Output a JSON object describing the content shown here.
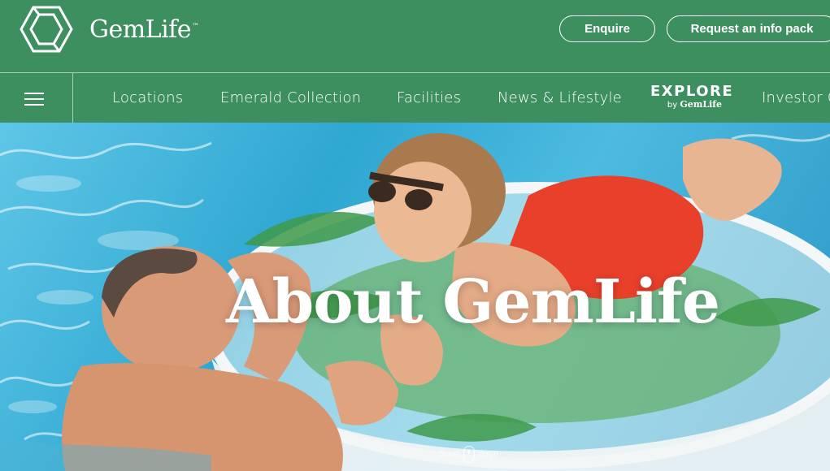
{
  "brand": {
    "name": "GemLife",
    "trademark": "™"
  },
  "header": {
    "enquire_label": "Enquire",
    "info_pack_label": "Request an info pack"
  },
  "nav": {
    "menu_icon": "hamburger-icon",
    "items": [
      {
        "label": "Locations"
      },
      {
        "label": "Emerald Collection"
      },
      {
        "label": "Facilities"
      },
      {
        "label": "News & Lifestyle"
      },
      {
        "label": "Investor C"
      }
    ],
    "explore": {
      "title": "EXPLORE",
      "by": "by",
      "brand": "GemLife"
    }
  },
  "hero": {
    "title": "About GemLife",
    "scroll_left": "Scroll",
    "scroll_right": "down"
  },
  "colors": {
    "brand_green": "#3d8f5f",
    "text": "#ffffff",
    "pool_blue": "#2ea7d2",
    "swimsuit_red": "#e8402b"
  }
}
